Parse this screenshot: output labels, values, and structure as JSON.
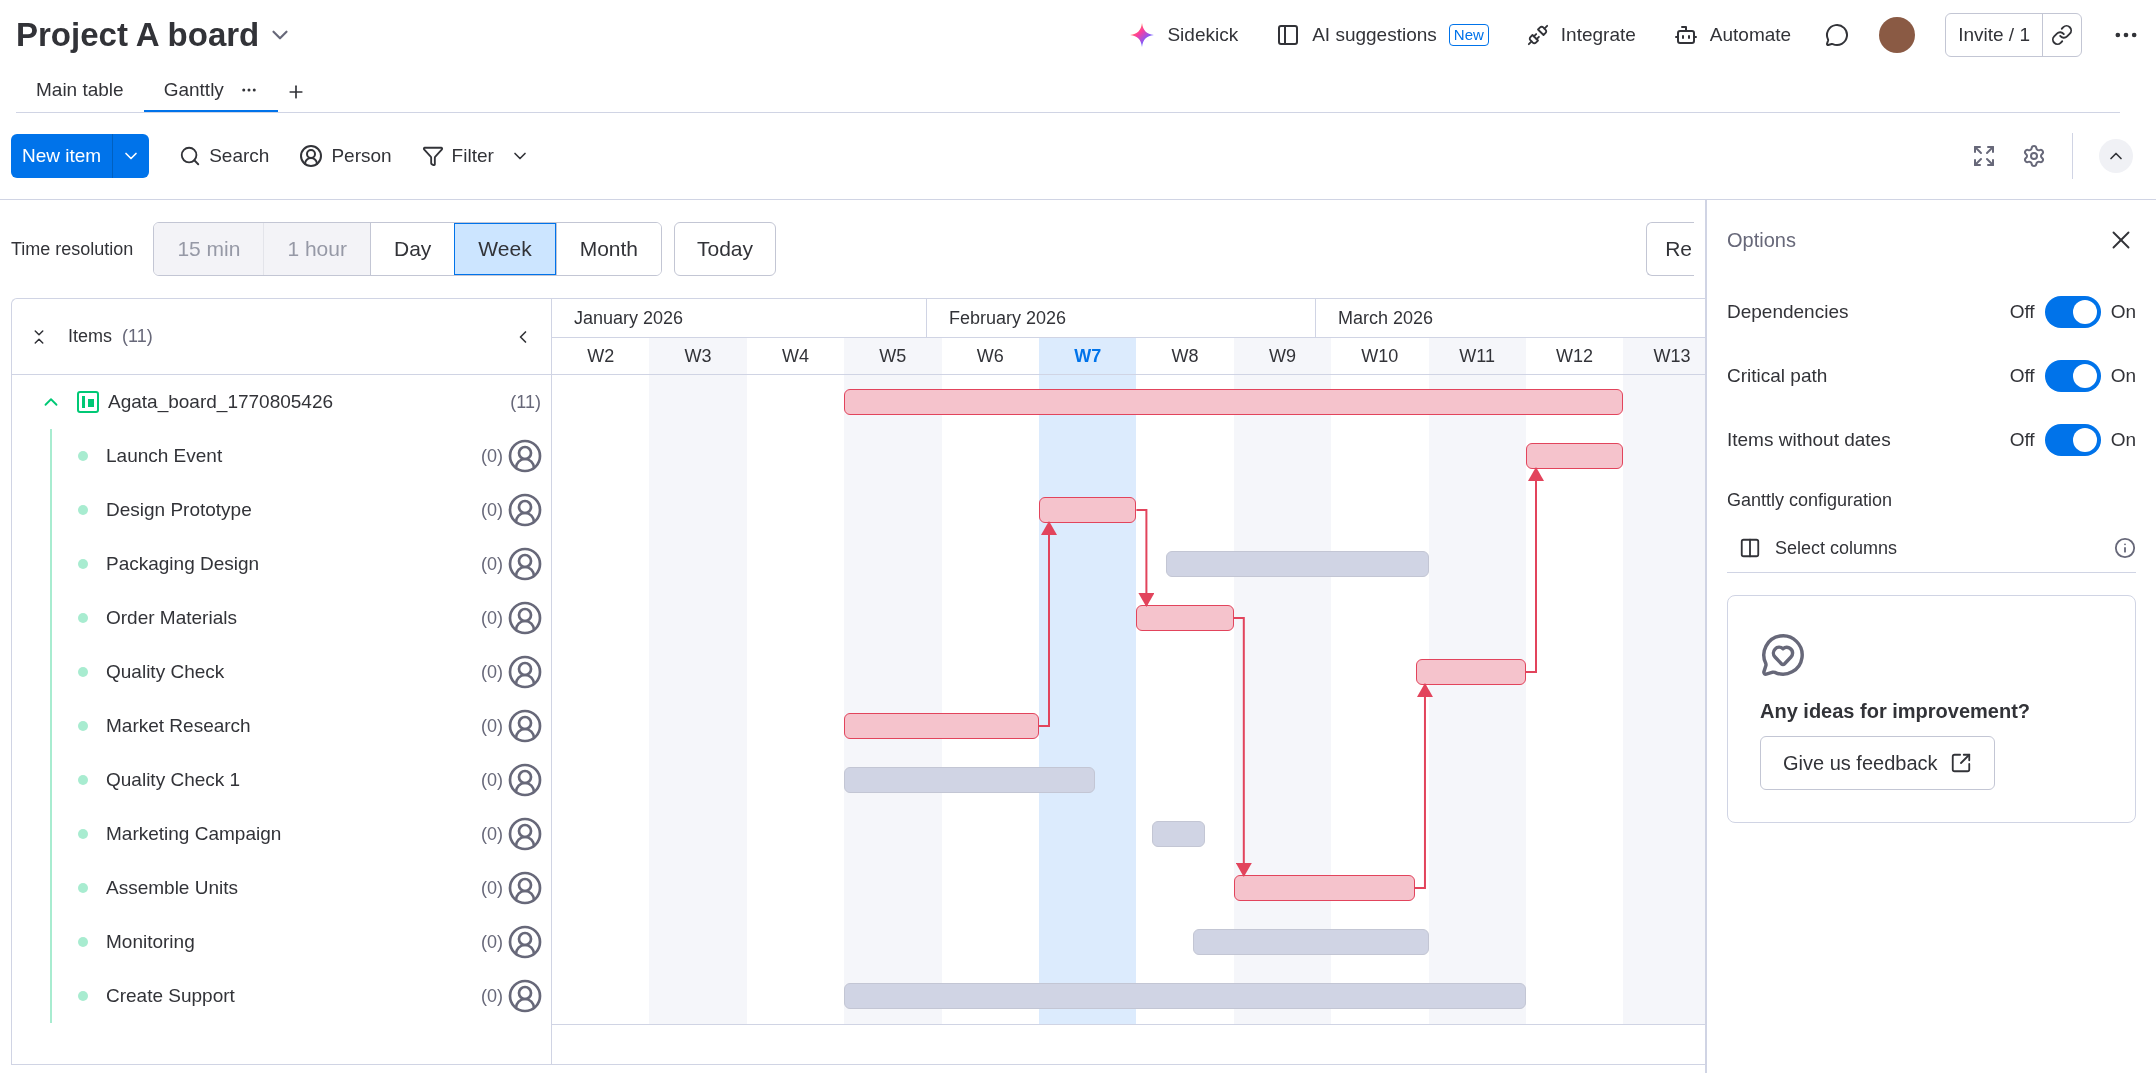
{
  "board": {
    "title": "Project A board"
  },
  "header_actions": [
    {
      "kind": "sidekick",
      "label": "Sidekick"
    },
    {
      "kind": "ai",
      "label": "AI suggestions",
      "badge": "New"
    },
    {
      "kind": "integrate",
      "label": "Integrate"
    },
    {
      "kind": "automate",
      "label": "Automate"
    }
  ],
  "invite": {
    "label": "Invite / 1"
  },
  "view_tabs": [
    {
      "label": "Main table",
      "selected": false
    },
    {
      "label": "Ganttly",
      "selected": true
    }
  ],
  "toolbar": {
    "new_item": "New item",
    "search": "Search",
    "person": "Person",
    "filter": "Filter"
  },
  "time_resolution": {
    "label": "Time resolution",
    "today": "Today",
    "cut_button": "Re",
    "options": [
      {
        "label": "15 min",
        "selected": false,
        "disabled": true
      },
      {
        "label": "1 hour",
        "selected": false,
        "disabled": true
      },
      {
        "label": "Day",
        "selected": false,
        "disabled": false
      },
      {
        "label": "Week",
        "selected": true,
        "disabled": false
      },
      {
        "label": "Month",
        "selected": false,
        "disabled": false
      }
    ]
  },
  "gantt": {
    "items_label": "Items",
    "items_count": "(11)",
    "months": [
      "January 2026",
      "February 2026",
      "March 2026"
    ],
    "weeks": [
      {
        "label": "W2",
        "current": false
      },
      {
        "label": "W3",
        "current": false
      },
      {
        "label": "W4",
        "current": false
      },
      {
        "label": "W5",
        "current": false
      },
      {
        "label": "W6",
        "current": false
      },
      {
        "label": "W7",
        "current": true
      },
      {
        "label": "W8",
        "current": false
      },
      {
        "label": "W9",
        "current": false
      },
      {
        "label": "W10",
        "current": false
      },
      {
        "label": "W11",
        "current": false
      },
      {
        "label": "W12",
        "current": false
      },
      {
        "label": "W13",
        "current": false
      }
    ],
    "group": {
      "name": "Agata_board_1770805426",
      "count": "(11)",
      "expanded": true,
      "critical": true
    },
    "items": [
      {
        "name": "Launch Event",
        "count": "(0)",
        "critical": true
      },
      {
        "name": "Design Prototype",
        "count": "(0)",
        "critical": true
      },
      {
        "name": "Packaging Design",
        "count": "(0)",
        "critical": false
      },
      {
        "name": "Order Materials",
        "count": "(0)",
        "critical": true
      },
      {
        "name": "Quality Check",
        "count": "(0)",
        "critical": true
      },
      {
        "name": "Market Research",
        "count": "(0)",
        "critical": true
      },
      {
        "name": "Quality Check 1",
        "count": "(0)",
        "critical": false
      },
      {
        "name": "Marketing Campaign",
        "count": "(0)",
        "critical": false
      },
      {
        "name": "Assemble Units",
        "count": "(0)",
        "critical": true
      },
      {
        "name": "Monitoring",
        "count": "(0)",
        "critical": false
      },
      {
        "name": "Create Support",
        "count": "(0)",
        "critical": false
      }
    ]
  },
  "options_panel": {
    "title": "Options",
    "toggles": [
      {
        "label": "Dependencies",
        "off_label": "Off",
        "on_label": "On",
        "on": true
      },
      {
        "label": "Critical path",
        "off_label": "Off",
        "on_label": "On",
        "on": true
      },
      {
        "label": "Items without dates",
        "off_label": "Off",
        "on_label": "On",
        "on": true
      }
    ],
    "config_title": "Ganttly configuration",
    "select_columns": "Select columns",
    "feedback": {
      "heading": "Any ideas for improvement?",
      "button": "Give us feedback"
    }
  }
}
